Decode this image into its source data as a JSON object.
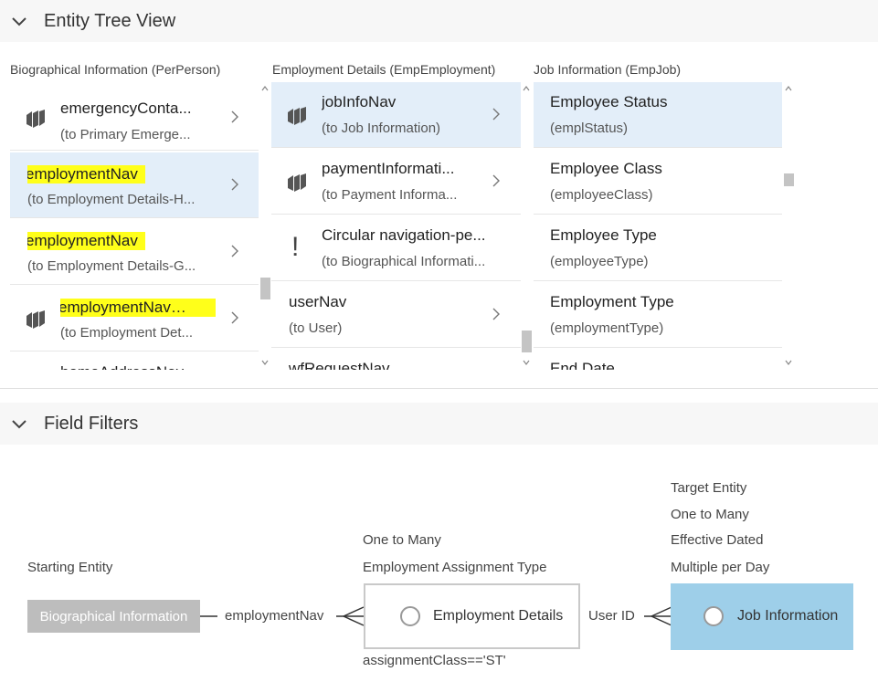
{
  "entity_tree": {
    "title": "Entity Tree View",
    "columns": [
      {
        "header": "Biographical Information (PerPerson)",
        "items": [
          {
            "title": "emergencyConta...",
            "subtitle": "(to Primary Emerge...",
            "icon": "entity-icon"
          },
          {
            "title": "employmentNav",
            "subtitle": "(to Employment Details-H...",
            "highlighted": true,
            "selected": true
          },
          {
            "title": "employmentNav",
            "subtitle": "(to Employment Details-G...",
            "highlighted": true
          },
          {
            "title": "employmentNav",
            "subtitle": "(to Employment Det...",
            "icon": "entity-icon",
            "highlighted": true
          },
          {
            "title": "homeAddressNav",
            "subtitle": ""
          }
        ]
      },
      {
        "header": "Employment Details (EmpEmployment)",
        "items": [
          {
            "title": "jobInfoNav",
            "subtitle": "(to Job Information)",
            "icon": "entity-icon",
            "selected": true
          },
          {
            "title": "paymentInformati...",
            "subtitle": "(to Payment Informa...",
            "icon": "entity-icon"
          },
          {
            "title": "Circular navigation-pe...",
            "subtitle": "(to Biographical Informati...",
            "icon": "warning-icon"
          },
          {
            "title": "userNav",
            "subtitle": "(to User)"
          },
          {
            "title": "wfRequestNav",
            "subtitle": ""
          }
        ]
      },
      {
        "header": "Job Information (EmpJob)",
        "items": [
          {
            "title": "Employee Status",
            "subtitle": "(emplStatus)",
            "selected": true
          },
          {
            "title": "Employee Class",
            "subtitle": "(employeeClass)"
          },
          {
            "title": "Employee Type",
            "subtitle": "(employeeType)"
          },
          {
            "title": "Employment Type",
            "subtitle": "(employmentType)"
          },
          {
            "title": "End Date",
            "subtitle": ""
          }
        ]
      }
    ]
  },
  "field_filters": {
    "title": "Field Filters",
    "starting_entity_label": "Starting Entity",
    "starting_entity": "Biographical Information",
    "nav1": "employmentNav",
    "middle_top": "One to Many",
    "middle_top2": "Employment Assignment Type",
    "middle_entity": "Employment Details",
    "middle_bottom": "assignmentClass=='ST'",
    "nav2": "User ID",
    "target_lines": [
      "Target Entity",
      "One to Many",
      "Effective Dated",
      "Multiple per Day"
    ],
    "target_entity": "Job Information"
  },
  "colors": {
    "highlight": "#ffff1a",
    "selected_row": "#e3eef9",
    "target_box": "#9ecfe9",
    "start_box": "#bdbdbd"
  }
}
